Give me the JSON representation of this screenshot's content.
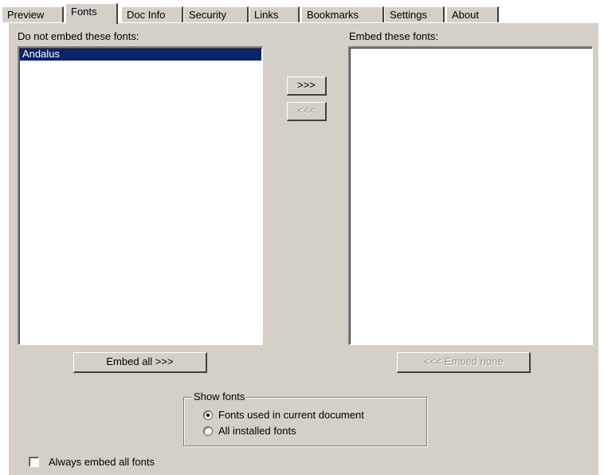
{
  "tabs": [
    {
      "label": "Preview",
      "active": false
    },
    {
      "label": "Fonts",
      "active": true
    },
    {
      "label": "Doc Info",
      "active": false
    },
    {
      "label": "Security",
      "active": false
    },
    {
      "label": "Links",
      "active": false
    },
    {
      "label": "Bookmarks",
      "active": false
    },
    {
      "label": "Settings",
      "active": false
    },
    {
      "label": "About",
      "active": false
    }
  ],
  "left_list": {
    "label": "Do not embed these fonts:",
    "items": [
      "Andalus"
    ],
    "selected_index": 0
  },
  "right_list": {
    "label": "Embed these fonts:",
    "items": []
  },
  "move_buttons": {
    "add": ">>>",
    "remove": "<<<"
  },
  "buttons": {
    "embed_all": "Embed all >>>",
    "embed_none": "<<< Embed none"
  },
  "show_fonts": {
    "title": "Show fonts",
    "options": [
      {
        "label": "Fonts used in current document",
        "checked": true
      },
      {
        "label": "All installed fonts",
        "checked": false
      }
    ]
  },
  "always_embed": {
    "label": "Always embed all fonts",
    "checked": false
  },
  "colors": {
    "dialog_bg": "#d4d0c8",
    "selection_bg": "#0a246a",
    "disabled_text": "#9a978f"
  }
}
